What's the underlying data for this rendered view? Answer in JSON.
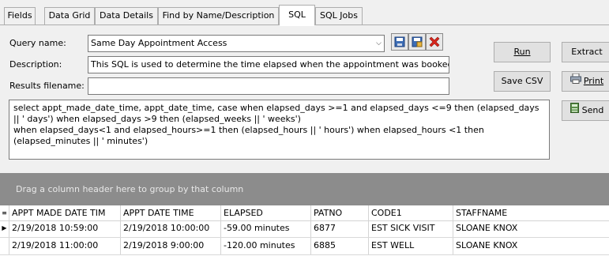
{
  "tabs": [
    {
      "label": "Fields"
    },
    {
      "label": "Data Grid"
    },
    {
      "label": "Data Details"
    },
    {
      "label": "Find by Name/Description"
    },
    {
      "label": "SQL"
    },
    {
      "label": "SQL Jobs"
    }
  ],
  "form": {
    "query_name_label": "Query name:",
    "query_name_value": "Same Day Appointment Access",
    "description_label": "Description:",
    "description_value": "This SQL is used to determine the time elapsed when the appointment was booked",
    "results_label": "Results filename:",
    "results_value": ""
  },
  "icons": [
    "save-icon",
    "save-as-icon",
    "delete-icon"
  ],
  "buttons": {
    "run": "Run",
    "extract": "Extract",
    "save_csv": "Save CSV",
    "print": "Print",
    "send": "Send"
  },
  "sql_text": "select appt_made_date_time, appt_date_time, case when elapsed_days >=1 and elapsed_days <=9 then (elapsed_days || ' days') when elapsed_days >9 then (elapsed_weeks || ' weeks')\nwhen elapsed_days<1 and elapsed_hours>=1 then (elapsed_hours || ' hours') when elapsed_hours <1 then (elapsed_minutes || ' minutes')",
  "grid": {
    "group_hint": "Drag a column header here to group by that column",
    "columns": [
      "APPT MADE DATE TIM",
      "APPT DATE TIME",
      "ELAPSED",
      "PATNO",
      "CODE1",
      "STAFFNAME"
    ],
    "rows": [
      [
        "2/19/2018 10:59:00",
        "2/19/2018 10:00:00",
        "-59.00 minutes",
        "6877",
        "EST SICK VISIT",
        "SLOANE KNOX"
      ],
      [
        "2/19/2018 11:00:00",
        "2/19/2018 9:00:00",
        "-120.00 minutes",
        "6885",
        "EST WELL",
        "SLOANE KNOX"
      ]
    ]
  },
  "colors": {
    "group_bar": "#8c8c8c",
    "delete_red": "#d9261c"
  }
}
